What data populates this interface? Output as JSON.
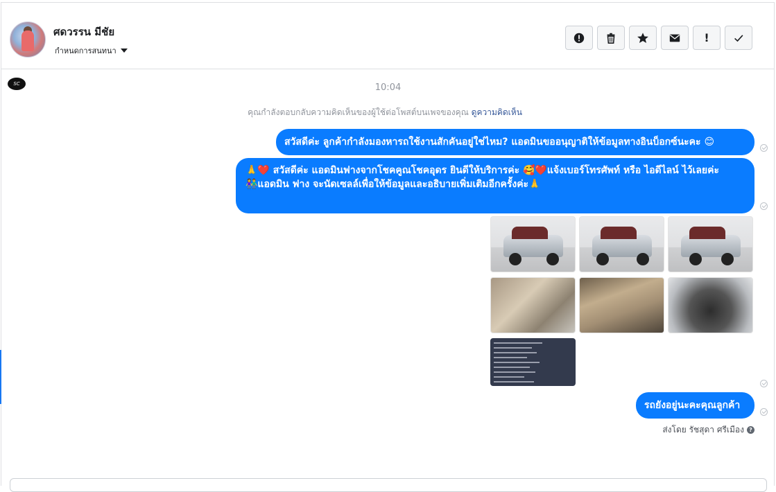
{
  "header": {
    "name": "ศดวรรน มีชัย",
    "subtitle": "กำหนดการสนทนา",
    "actions": [
      {
        "icon": "alert-circle-icon",
        "label": ""
      },
      {
        "icon": "trash-icon",
        "label": ""
      },
      {
        "icon": "star-icon",
        "label": ""
      },
      {
        "icon": "envelope-icon",
        "label": ""
      },
      {
        "icon": "exclamation-icon",
        "label": "!"
      },
      {
        "icon": "checkmark-icon",
        "label": ""
      }
    ]
  },
  "conversation": {
    "timestamp": "10:04",
    "notice_text": "คุณกำลังตอบกลับความคิดเห็นของผู้ใช้ต่อโพสต์บนเพจของคุณ",
    "notice_link": "ดูความคิดเห็น",
    "messages": [
      {
        "text": "สวัสดีค่ะ ลูกค้ากำลังมองหารถใช้งานสักคันอยู่ใช่ไหม? แอดมินขออนุญาติให้ข้อมูลทางอินบ็อกซ์นะคะ 😊"
      },
      {
        "text": "🙏❤️ สวัสดีค่ะ แอดมินฟางจากโชคคูณโชคอุดร ยินดีให้บริการค่ะ 🥰❤️แจ้งเบอร์โทรศัพท์ หรือ ไอดีไลน์ ไว้เลยค่ะ\n👫แอดมิน ฟาง จะนัดเซลล์เพื่อให้ข้อมูลและอธิบายเพิ่มเติมอีกครั้งค่ะ🙏"
      },
      {
        "text": "รถยังอยู่นะคะคุณลูกค้า"
      }
    ],
    "photos": [
      "truck-front-photo",
      "truck-side-photo",
      "truck-front-right-photo",
      "interior-seat-photo",
      "door-panel-photo",
      "engine-bay-photo",
      "spec-sheet-photo"
    ],
    "sent_by": "ส่งโดย รัชสุดา ศรีเมือง"
  },
  "colors": {
    "bubble": "#0a7cff",
    "link": "#365899",
    "muted": "#90949c"
  }
}
